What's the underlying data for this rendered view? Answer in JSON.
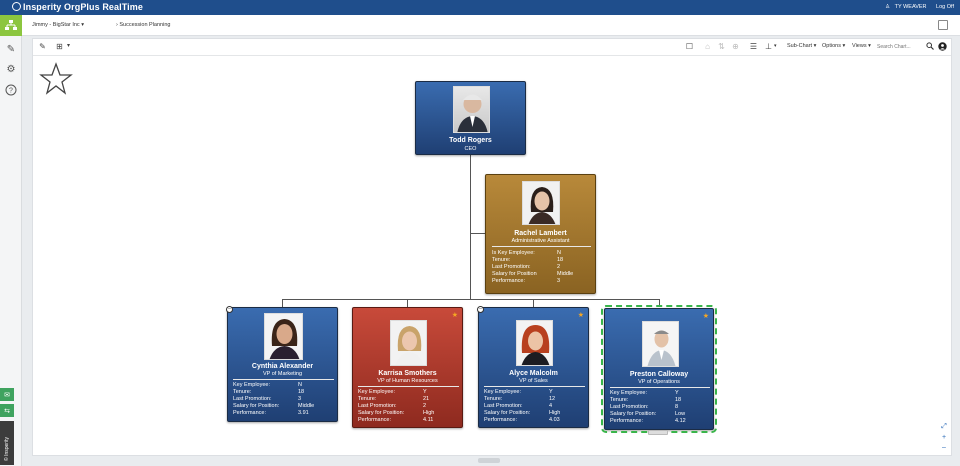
{
  "header": {
    "brand": "Insperity OrgPlus RealTime",
    "user": "TY WEAVER",
    "logoff": "Log Off"
  },
  "breadcrumb": {
    "org": "Jimmy - BigStar Inc",
    "chart": "Succession Planning"
  },
  "toolbar": {
    "subchart": "Sub-Chart",
    "options": "Options",
    "views": "Views",
    "search_placeholder": "Search Chart..."
  },
  "rail": {
    "brand": "© Insperity"
  },
  "chart": {
    "ceo": {
      "name": "Todd Rogers",
      "title": "CEO"
    },
    "assistant": {
      "name": "Rachel Lambert",
      "title": "Administrative Assistant",
      "fields": [
        {
          "label": "Is Key Employee:",
          "value": "N"
        },
        {
          "label": "Tenure:",
          "value": "18"
        },
        {
          "label": "Last Promotion:",
          "value": "2"
        },
        {
          "label": "Salary for Position",
          "value": "Middle"
        },
        {
          "label": "Performance:",
          "value": "3"
        }
      ]
    },
    "reports": [
      {
        "name": "Cynthia Alexander",
        "title": "VP of Marketing",
        "color": "blue",
        "fields": [
          {
            "label": "Key Employee:",
            "value": "N"
          },
          {
            "label": "Tenure:",
            "value": "18"
          },
          {
            "label": "Last Promotion:",
            "value": "3"
          },
          {
            "label": "Salary for Position:",
            "value": "Middle"
          },
          {
            "label": "Performance:",
            "value": "3.91"
          }
        ]
      },
      {
        "name": "Karrisa Smothers",
        "title": "VP of Human Resources",
        "color": "red",
        "fields": [
          {
            "label": "Key Employee:",
            "value": "Y"
          },
          {
            "label": "Tenure:",
            "value": "21"
          },
          {
            "label": "Last Promotion:",
            "value": "2"
          },
          {
            "label": "Salary for Position:",
            "value": "High"
          },
          {
            "label": "Performance:",
            "value": "4.11"
          }
        ]
      },
      {
        "name": "Alyce Malcolm",
        "title": "VP of Sales",
        "color": "blue",
        "fields": [
          {
            "label": "Key Employee:",
            "value": "Y"
          },
          {
            "label": "Tenure:",
            "value": "12"
          },
          {
            "label": "Last Promotion:",
            "value": "4"
          },
          {
            "label": "Salary for Position:",
            "value": "High"
          },
          {
            "label": "Performance:",
            "value": "4.03"
          }
        ]
      },
      {
        "name": "Preston Calloway",
        "title": "VP of Operations",
        "color": "blue",
        "fields": [
          {
            "label": "Key Employee:",
            "value": "Y"
          },
          {
            "label": "Tenure:",
            "value": "18"
          },
          {
            "label": "Last Promotion:",
            "value": "8"
          },
          {
            "label": "Salary for Position:",
            "value": "Low"
          },
          {
            "label": "Performance:",
            "value": "4.12"
          }
        ]
      }
    ]
  },
  "colors": {
    "header_bg": "#1f4e8c",
    "rail_active": "#8cc63f",
    "card_blue": "#2b5595",
    "card_red": "#b03e30",
    "card_gold": "#a87b30",
    "selection": "#3ab54a"
  }
}
